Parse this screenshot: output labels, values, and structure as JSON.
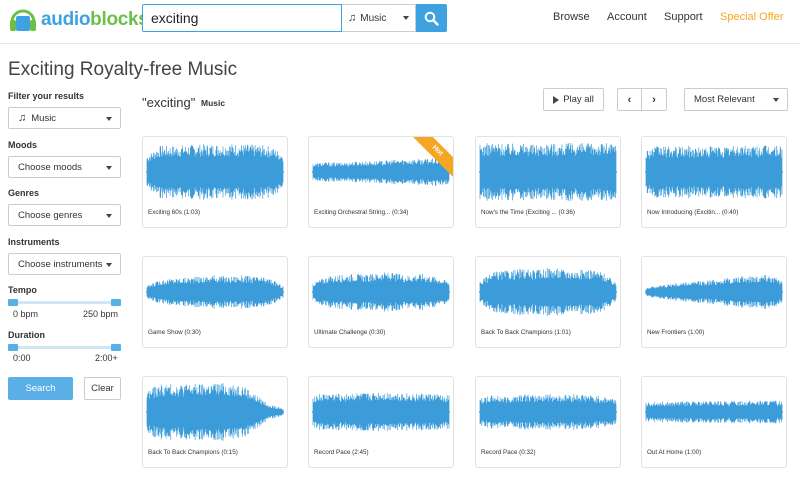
{
  "header": {
    "logo_part1": "audio",
    "logo_part2": "blocks",
    "search_value": "exciting",
    "search_type": "Music",
    "nav": [
      "Browse",
      "Account",
      "Support",
      "Special Offer"
    ]
  },
  "page_title": "Exciting Royalty-free Music",
  "sidebar": {
    "filter_label": "Filter your results",
    "type_value": "Music",
    "moods_label": "Moods",
    "moods_value": "Choose moods",
    "genres_label": "Genres",
    "genres_value": "Choose genres",
    "instruments_label": "Instruments",
    "instruments_value": "Choose instruments",
    "tempo_label": "Tempo",
    "tempo_min": "0 bpm",
    "tempo_max": "250 bpm",
    "duration_label": "Duration",
    "duration_min": "0:00",
    "duration_max": "2:00+",
    "search_label": "Search",
    "clear_label": "Clear"
  },
  "results": {
    "query": "\"exciting\"",
    "type": "Music",
    "play_all_label": "Play all",
    "prev_glyph": "‹",
    "next_glyph": "›",
    "sort_value": "Most Relevant",
    "hot_label": "Hot",
    "items": [
      {
        "title": "Exciting 60s (1:03)"
      },
      {
        "title": "Exciting Orchestral String... (0:34)"
      },
      {
        "title": "Now's the Time (Exciting ... (0:36)"
      },
      {
        "title": "Now Introducing (Excitin... (0:40)"
      },
      {
        "title": "Game Show (0:30)"
      },
      {
        "title": "Ultimate Challenge (0:30)"
      },
      {
        "title": "Back To Back Champions (1:01)"
      },
      {
        "title": "New Frontiers (1:00)"
      },
      {
        "title": "Back To Back Champions (0:15)"
      },
      {
        "title": "Record Pace (2:45)"
      },
      {
        "title": "Record Pace (0:32)"
      },
      {
        "title": "Out At Home (1:00)"
      }
    ]
  },
  "colors": {
    "accent": "#3ea2e0",
    "wave": "#3b9cd9",
    "offer": "#f5a623",
    "logo_green": "#6cc04a"
  }
}
